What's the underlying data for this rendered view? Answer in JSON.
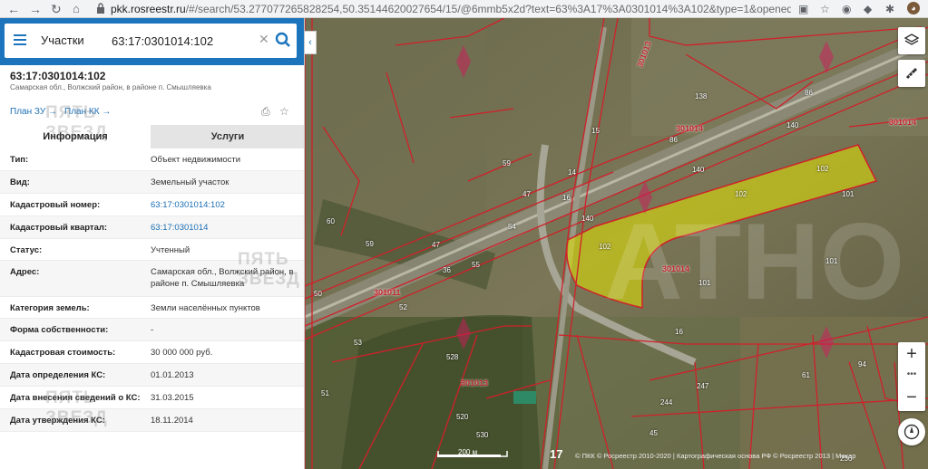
{
  "browser": {
    "url_host": "pkk.rosreestr.ru",
    "url_path": "/#/search/53.277077265828254,50.35144620027654/15/@6mmb5x2d?text=63%3A17%3A0301014%3A102&type=1&opened=63%3A17..."
  },
  "search": {
    "category": "Участки",
    "value": "63:17:0301014:102"
  },
  "object": {
    "title": "63:17:0301014:102",
    "address": "Самарская обл., Волжский район, в районе п. Смышляевка",
    "plan_zu": "План ЗУ →",
    "plan_kk": "План КК →"
  },
  "tabs": [
    "Информация",
    "Услуги"
  ],
  "rows": [
    {
      "label": "Тип:",
      "value": "Объект недвижимости"
    },
    {
      "label": "Вид:",
      "value": "Земельный участок"
    },
    {
      "label": "Кадастровый номер:",
      "value": "63:17:0301014:102"
    },
    {
      "label": "Кадастровый квартал:",
      "value": "63:17:0301014"
    },
    {
      "label": "Статус:",
      "value": "Учтенный"
    },
    {
      "label": "Адрес:",
      "value": "Самарская обл., Волжский район, в районе п. Смышляевка"
    },
    {
      "label": "Категория земель:",
      "value": "Земли населённых пунктов"
    },
    {
      "label": "Форма собственности:",
      "value": "-"
    },
    {
      "label": "Кадастровая стоимость:",
      "value": "30 000 000 руб."
    },
    {
      "label": "Дата определения КС:",
      "value": "01.01.2013"
    },
    {
      "label": "Дата внесения сведений о КС:",
      "value": "31.03.2015"
    },
    {
      "label": "Дата утверждения КС:",
      "value": "18.11.2014"
    }
  ],
  "watermark": {
    "line1": "ПЯТЬ",
    "line2": "ЗВЕЗД"
  },
  "map": {
    "quarters": [
      "301014",
      "301014",
      "301014",
      "301011",
      "301013",
      "301013"
    ],
    "parcel_labels": [
      "102",
      "102",
      "102",
      "140",
      "140",
      "140",
      "101",
      "101",
      "101",
      "86",
      "86",
      "138",
      "15",
      "14",
      "16",
      "47",
      "47",
      "59",
      "60",
      "54",
      "55",
      "36",
      "59",
      "50",
      "53",
      "52",
      "51",
      "528",
      "520",
      "530",
      "244",
      "247",
      "16",
      "94",
      "61",
      "236",
      "45"
    ],
    "scale_label": "200 м",
    "zoom_level": "17",
    "attribution": "© ПКК © Росреестр 2010-2020 | Картографическая основа РФ © Росреестр 2013 | Макар"
  },
  "colors": {
    "accent": "#1c75bc",
    "parcel_fill": "#e5e600",
    "boundary": "#d0202a"
  }
}
